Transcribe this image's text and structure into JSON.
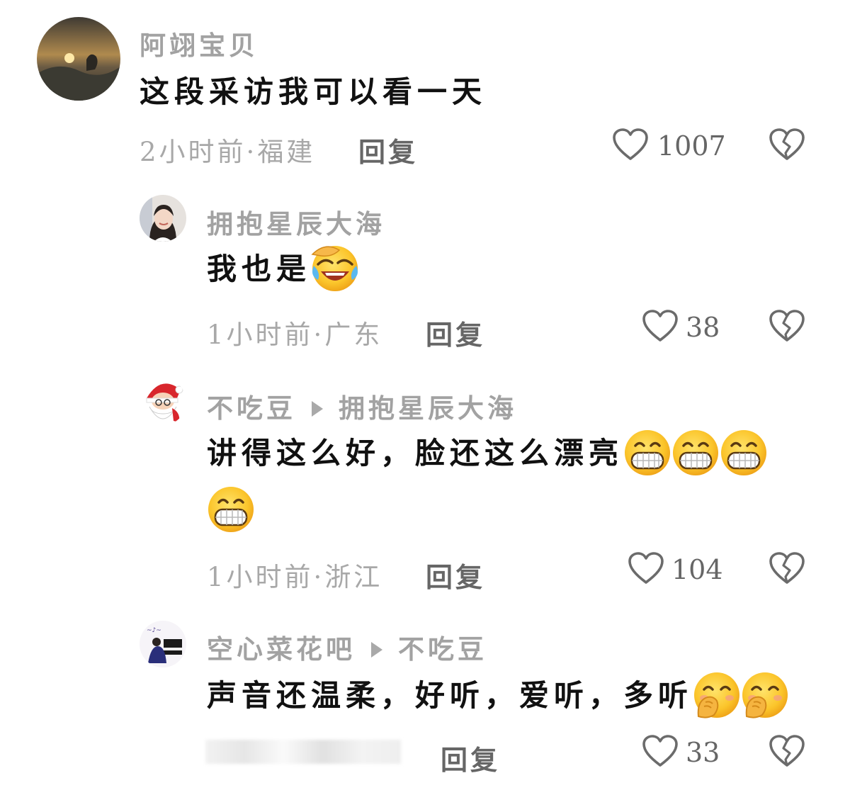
{
  "comments": [
    {
      "username": "阿翊宝贝",
      "text": "这段采访我可以看一天",
      "time": "2小时前",
      "location": "福建",
      "reply_label": "回复",
      "likes": "1007",
      "avatar": "sunset-avatar-icon"
    },
    {
      "username": "拥抱星辰大海",
      "text": "我也是",
      "emoji": "crying-laughing-emoji",
      "time": "1小时前",
      "location": "广东",
      "reply_label": "回复",
      "likes": "38",
      "avatar": "girl-avatar-icon"
    },
    {
      "username": "不吃豆",
      "reply_to": "拥抱星辰大海",
      "text": "讲得这么好，脸还这么漂亮",
      "emoji": "grin-emoji",
      "emoji_count": 4,
      "time": "1小时前",
      "location": "浙江",
      "reply_label": "回复",
      "likes": "104",
      "avatar": "santa-avatar-icon"
    },
    {
      "username": "空心菜花吧",
      "reply_to": "不吃豆",
      "text": "声音还温柔，好听，爱听，多听",
      "emoji": "covering-mouth-emoji",
      "emoji_count": 2,
      "reply_label": "回复",
      "likes": "33",
      "avatar": "piano-avatar-icon"
    }
  ],
  "colors": {
    "muted_text": "#a8a8a8",
    "body_text": "#111111",
    "action_text": "#666666"
  }
}
